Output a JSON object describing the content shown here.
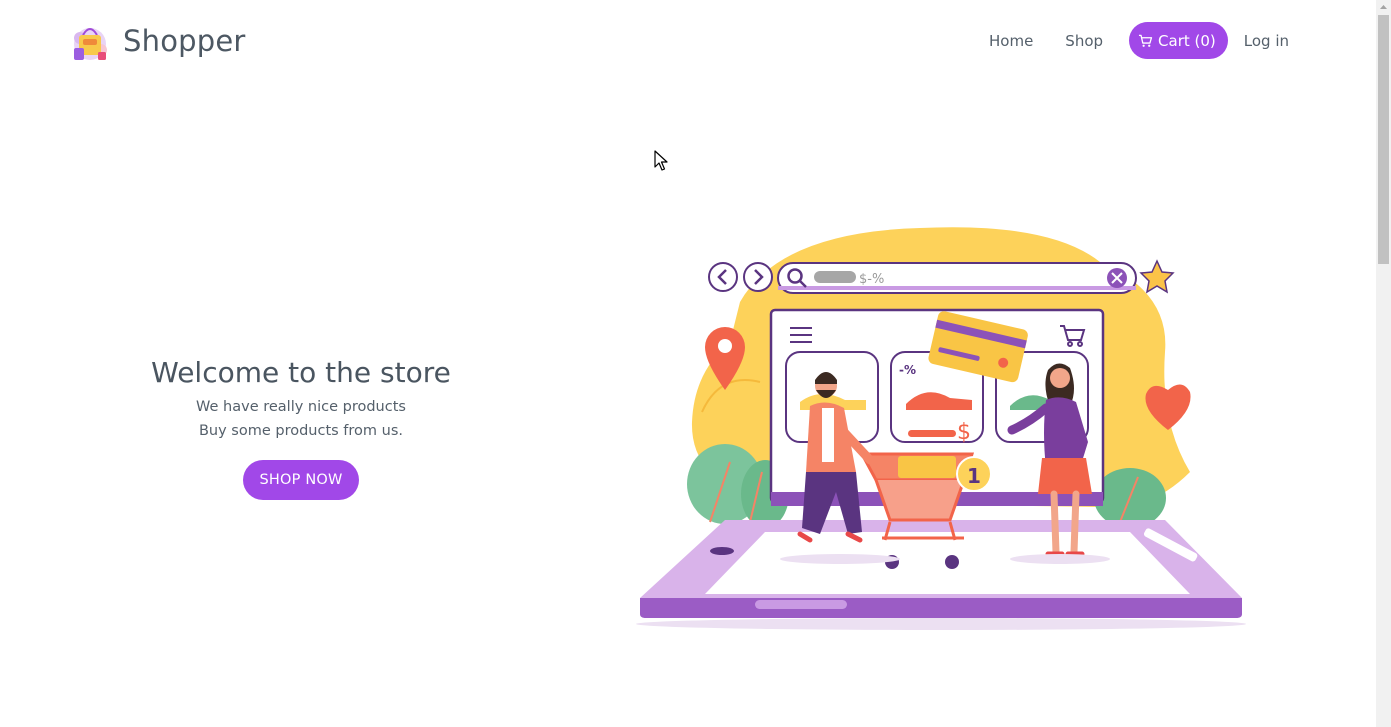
{
  "header": {
    "brand_name": "Shopper",
    "nav": {
      "home": "Home",
      "shop": "Shop",
      "cart": "Cart (0)",
      "login": "Log in"
    }
  },
  "hero": {
    "title": "Welcome to the store",
    "line1": "We have really nice products",
    "line2": "Buy some products from us.",
    "cta": "SHOP NOW"
  },
  "illustration": {
    "search_text": "$-%",
    "discount_tag": "-%",
    "price_symbol": "$",
    "cart_count_badge": "1"
  },
  "colors": {
    "accent": "#a148e8",
    "text": "#4a5560"
  },
  "icons": {
    "brand": "shopping-bag-logo-icon",
    "cart": "cart-icon"
  }
}
